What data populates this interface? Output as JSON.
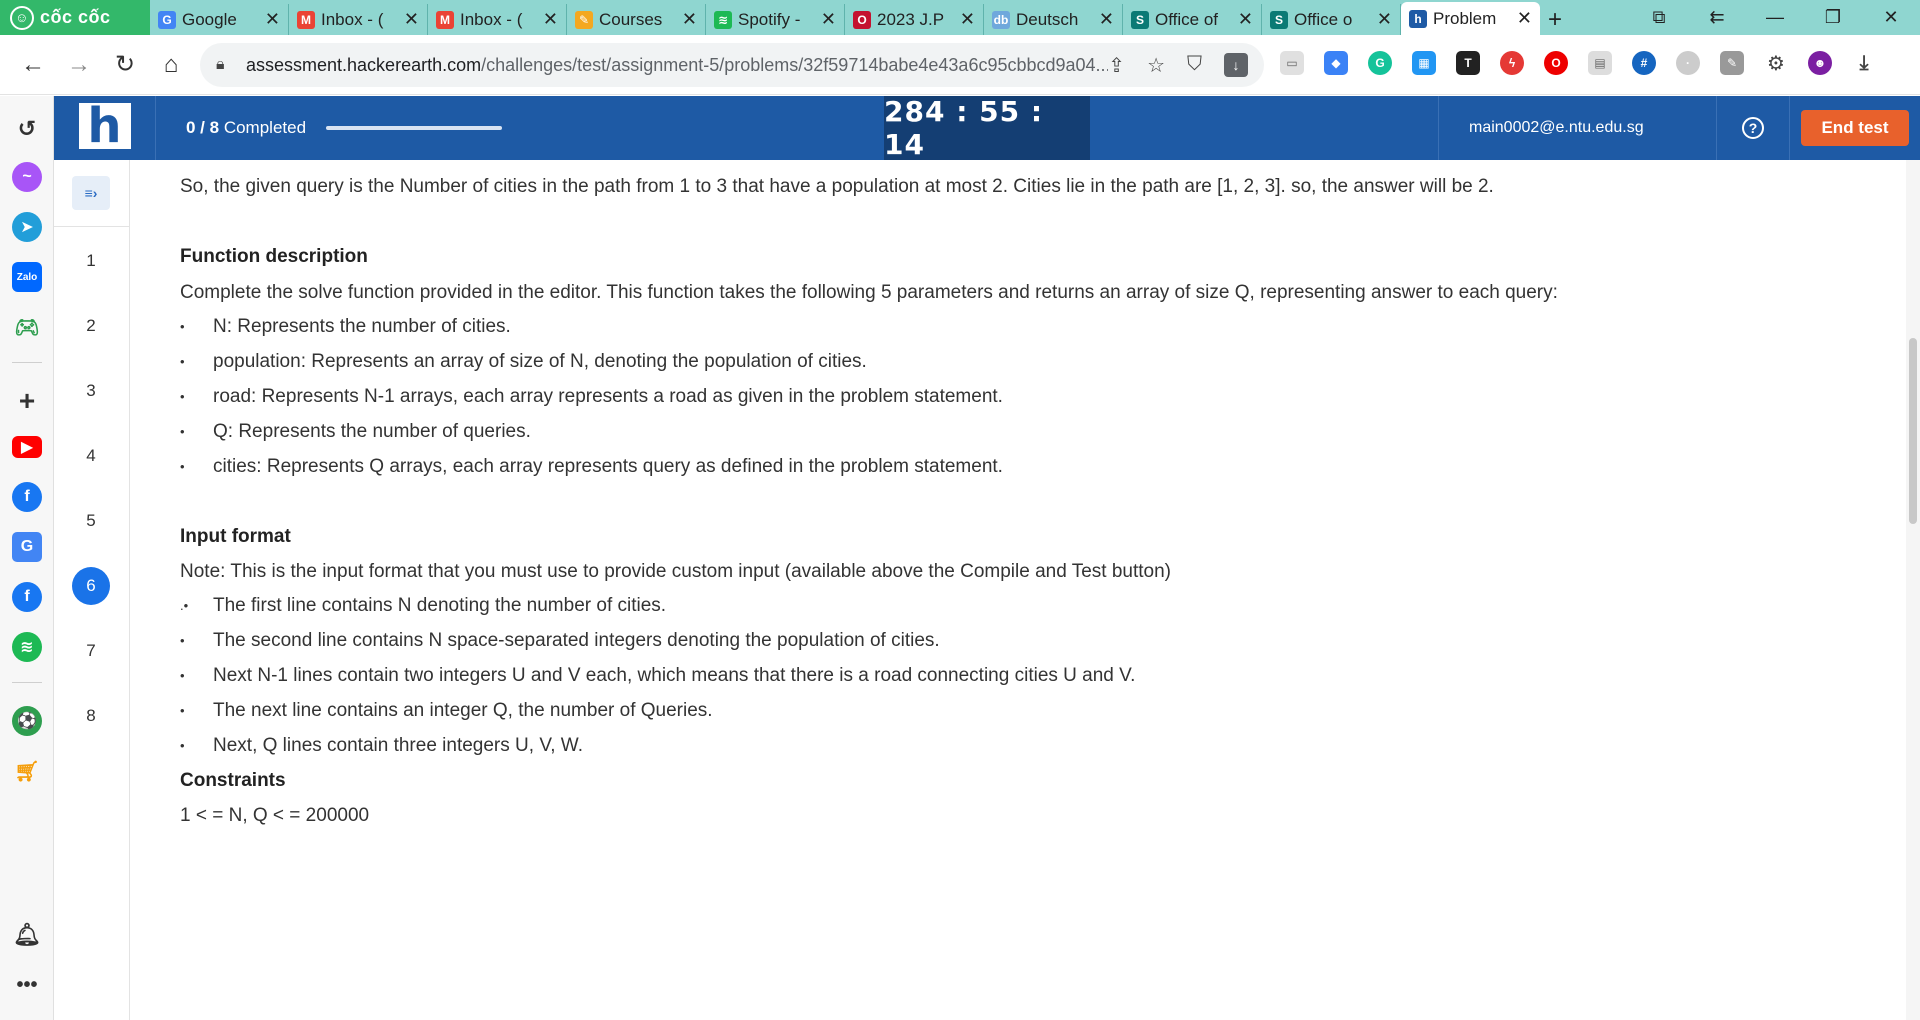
{
  "browser": {
    "brand": "cốc cốc",
    "tabs": [
      {
        "label": "Google",
        "favicon": "google-drive-icon",
        "color": "#4285f4",
        "glyph": "G"
      },
      {
        "label": "Inbox - (",
        "favicon": "gmail-icon",
        "color": "#ea4335",
        "glyph": "M"
      },
      {
        "label": "Inbox - (",
        "favicon": "gmail-icon",
        "color": "#ea4335",
        "glyph": "M"
      },
      {
        "label": "Courses",
        "favicon": "courses-icon",
        "color": "#f4a820",
        "glyph": "✎"
      },
      {
        "label": "Spotify -",
        "favicon": "spotify-icon",
        "color": "#1db954",
        "glyph": "≋"
      },
      {
        "label": "2023 J.P",
        "favicon": "jpmorgan-icon",
        "color": "#c4122f",
        "glyph": "O"
      },
      {
        "label": "Deutsch",
        "favicon": "deutsche-bank-icon",
        "color": "#6fa8dc",
        "glyph": "db"
      },
      {
        "label": "Office of",
        "favicon": "sharepoint-icon",
        "color": "#0b7a75",
        "glyph": "S"
      },
      {
        "label": "Office o",
        "favicon": "sharepoint-icon",
        "color": "#0b7a75",
        "glyph": "S"
      },
      {
        "label": "Problem",
        "favicon": "hackerearth-icon",
        "color": "#1e5aa5",
        "glyph": "h",
        "active": true
      }
    ],
    "new_tab": "+",
    "url_host": "assessment.hackerearth.com",
    "url_path": "/challenges/test/assignment-5/problems/32f59714babe4e43a6c95cbbcd9a04..."
  },
  "header": {
    "completed_count": "0 / 8",
    "completed_label": "Completed",
    "progress_fraction": 0,
    "timer": "284 : 55 : 14",
    "email": "main0002@e.ntu.edu.sg",
    "help": "?",
    "end_test": "End test"
  },
  "questions": [
    "1",
    "2",
    "3",
    "4",
    "5",
    "6",
    "7",
    "8"
  ],
  "active_question": "6",
  "content": {
    "explanation": "So, the given query is the Number of cities in the path from 1 to 3 that have a population at most 2. Cities lie in the path are [1, 2, 3].  so, the answer will be 2.",
    "function_heading": "Function description",
    "function_intro": "Complete the solve function provided in the editor. This function takes the following 5 parameters and returns an array of size Q, representing answer to each query:",
    "params": [
      "N: Represents the number of cities.",
      "population: Represents an array of size of N, denoting the population of cities.",
      "road: Represents N-1 arrays, each array represents a road as given in the problem statement.",
      "Q: Represents the number of queries.",
      "cities: Represents Q arrays, each array represents query as defined in the problem statement."
    ],
    "input_heading": "Input format",
    "input_note": "Note: This is the input format that you must use to provide custom input (available above the Compile and Test button)",
    "input_lines": [
      "The first line contains N denoting the number of cities.",
      "The second line contains N space-separated integers denoting the population of cities.",
      "Next N-1 lines contain two integers U and V each, which means that there is a road connecting cities U and V.",
      "The next line contains an integer Q, the number of Queries.",
      "Next, Q lines contain three integers U, V, W."
    ],
    "constraints_heading": "Constraints",
    "constraint_1": "1 < = N, Q < = 200000"
  },
  "colors": {
    "header_bg": "#1e5aa5",
    "timer_bg": "#143e73",
    "end_test_bg": "#e8612c",
    "active_question": "#1a73e8",
    "tab_strip": "#8fd6d0"
  }
}
